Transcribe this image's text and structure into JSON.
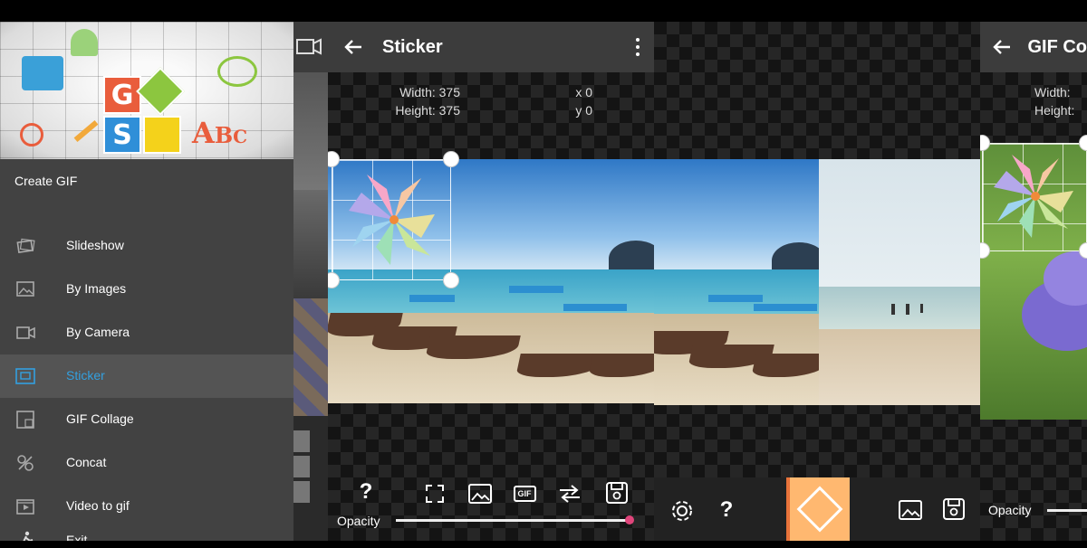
{
  "colors": {
    "accent": "#33a0e0",
    "slider_knob": "#e0457b",
    "app_bar": "#3c3c3c",
    "menu_bg": "#424242",
    "selected_row": "#545454",
    "diamond_button": "#ffb870"
  },
  "menu": {
    "header_letters": [
      "G",
      "S",
      "A",
      "B",
      "C"
    ],
    "title": "Create GIF",
    "items": [
      {
        "label": "Slideshow",
        "icon": "slideshow-icon",
        "selected": false
      },
      {
        "label": "By Images",
        "icon": "image-icon",
        "selected": false
      },
      {
        "label": "By Camera",
        "icon": "camera-icon",
        "selected": false
      },
      {
        "label": "Sticker",
        "icon": "sticker-icon",
        "selected": true
      },
      {
        "label": "GIF Collage",
        "icon": "collage-icon",
        "selected": false
      },
      {
        "label": "Concat",
        "icon": "concat-icon",
        "selected": false
      },
      {
        "label": "Video to gif",
        "icon": "video-icon",
        "selected": false
      },
      {
        "label": "Exit",
        "icon": "exit-icon",
        "selected": false
      }
    ]
  },
  "sticker": {
    "title": "Sticker",
    "width_label": "Width:",
    "width_value": "375",
    "height_label": "Height:",
    "height_value": "375",
    "x_label": "x",
    "x_value": "0",
    "y_label": "y",
    "y_value": "0",
    "help": "?",
    "gif_label": "GIF",
    "opacity_label": "Opacity",
    "opacity": 1.0
  },
  "edit": {
    "help": "?"
  },
  "collage": {
    "title": "GIF Co",
    "width_label": "Width:",
    "height_label": "Height:",
    "opacity_label": "Opacity"
  }
}
